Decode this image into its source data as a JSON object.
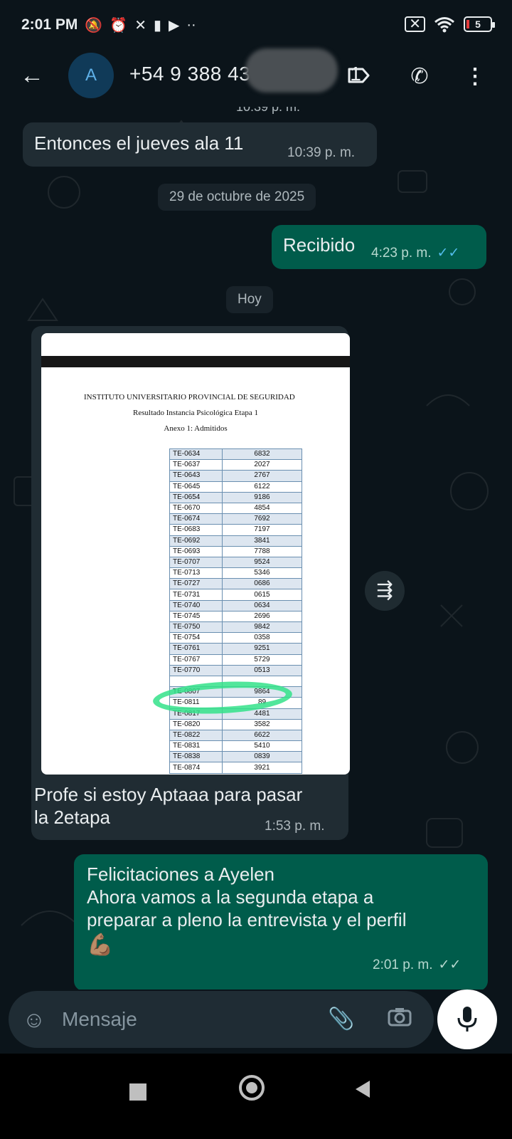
{
  "status_bar": {
    "time": "2:01 PM",
    "left_icons": [
      "bell-off-icon",
      "alarm-icon",
      "app-icon",
      "clipboard-icon",
      "youtube-icon",
      "more-dots-icon"
    ],
    "right_icons": [
      "sim-off-icon",
      "wifi-icon",
      "battery-icon"
    ],
    "battery_level": "5"
  },
  "header": {
    "avatar_letter": "A",
    "contact": "+54 9 388 43",
    "contact_tail": "1",
    "icons": [
      "back-arrow-icon",
      "label-icon",
      "add-call-icon",
      "more-vert-icon"
    ]
  },
  "messages": {
    "m0_time_partial": "10:39 p. m.",
    "m1_text": "Entonces  el jueves ala 11",
    "m1_time": "10:39 p. m.",
    "date1": "29 de octubre de 2025",
    "m2_text": "Recibido",
    "m2_time": "4:23 p. m.",
    "date2": "Hoy",
    "m3_caption_line1": "Profe si estoy Aptaaa para pasar",
    "m3_caption_line2": "la 2etapa",
    "m3_time": "1:53 p. m.",
    "m4_line1": "Felicitaciones a Ayelen",
    "m4_line2": "Ahora vamos a la segunda etapa a",
    "m4_line3": "preparar a pleno la entrevista y el perfil",
    "m4_emoji": "💪🏽",
    "m4_time": "2:01 p. m."
  },
  "document": {
    "title": "INSTITUTO UNIVERSITARIO PROVINCIAL DE SEGURIDAD",
    "subtitle": "Resultado Instancia Psicológica Etapa 1",
    "annex": "Anexo 1: Admitidos",
    "rows": [
      [
        "TE-0634",
        "6832"
      ],
      [
        "TE-0637",
        "2027"
      ],
      [
        "TE-0643",
        "2767"
      ],
      [
        "TE-0645",
        "6122"
      ],
      [
        "TE-0654",
        "9186"
      ],
      [
        "TE-0670",
        "4854"
      ],
      [
        "TE-0674",
        "7692"
      ],
      [
        "TE-0683",
        "7197"
      ],
      [
        "TE-0692",
        "3841"
      ],
      [
        "TE-0693",
        "7788"
      ],
      [
        "TE-0707",
        "9524"
      ],
      [
        "TE-0713",
        "5346"
      ],
      [
        "TE-0727",
        "0686"
      ],
      [
        "TE-0731",
        "0615"
      ],
      [
        "TE-0740",
        "0634"
      ],
      [
        "TE-0745",
        "2696"
      ],
      [
        "TE-0750",
        "9842"
      ],
      [
        "TE-0754",
        "0358"
      ],
      [
        "TE-0761",
        "9251"
      ],
      [
        "TE-0767",
        "5729"
      ],
      [
        "TE-0770",
        "0513"
      ],
      [
        "",
        ""
      ],
      [
        "TE-0807",
        "9864"
      ],
      [
        "TE-0811",
        "89"
      ],
      [
        "TE-0817",
        "4481"
      ],
      [
        "TE-0820",
        "3582"
      ],
      [
        "TE-0822",
        "6622"
      ],
      [
        "TE-0831",
        "5410"
      ],
      [
        "TE-0838",
        "0839"
      ],
      [
        "TE-0874",
        "3921"
      ]
    ],
    "highlight_color": "#34e28a"
  },
  "composer": {
    "placeholder": "Mensaje",
    "icons": [
      "sticker-icon",
      "attach-icon",
      "camera-icon",
      "mic-icon"
    ]
  },
  "colors": {
    "background": "#0b141a",
    "incoming_bubble": "#202c33",
    "outgoing_bubble": "#005c4b",
    "read_ticks": "#53bdeb"
  }
}
